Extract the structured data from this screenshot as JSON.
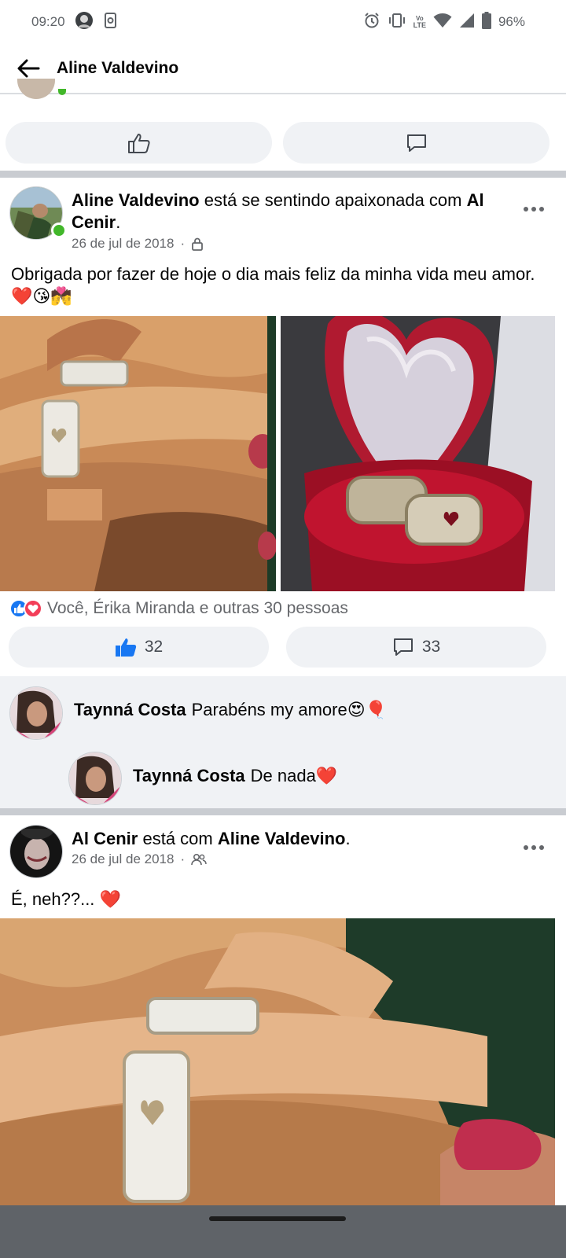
{
  "status_bar": {
    "time": "09:20",
    "battery": "96%",
    "icons": [
      "avatar-icon",
      "screen-record-icon",
      "alarm-icon",
      "vibrate-icon",
      "volte-icon",
      "wifi-icon",
      "signal-icon",
      "battery-icon"
    ],
    "lte_label": "LTE"
  },
  "header": {
    "title": "Aline Valdevino",
    "back_icon": "arrow-left-icon"
  },
  "post1": {
    "author": "Aline Valdevino",
    "feeling": " está se sentindo apaixonada com ",
    "tagged": "Al Cenir",
    "period": ".",
    "date": "26 de jul de 2018",
    "dot": "·",
    "privacy_icon": "lock-icon",
    "text": "Obrigada por fazer de hoje o dia mais feliz da minha vida meu amor.❤️😘💏",
    "reactions_text": "Você, Érika Miranda e outras 30 pessoas",
    "like_count": "32",
    "comment_count": "33"
  },
  "comments": [
    {
      "author": "Taynná Costa",
      "text": "Parabéns my amore😍🎈"
    },
    {
      "author": "Taynná Costa",
      "text": "De nada❤️"
    }
  ],
  "post2": {
    "author": "Al Cenir",
    "with": " está com ",
    "tagged": "Aline Valdevino",
    "period": ".",
    "date": "26 de jul de 2018",
    "dot": "·",
    "privacy_icon": "friends-icon",
    "text": "É, neh??... ❤️"
  },
  "colors": {
    "like_blue": "#1877f2",
    "love_red": "#f33e58",
    "online_green": "#42b72a",
    "pill_bg": "#f0f2f5",
    "secondary_text": "#65676b"
  }
}
